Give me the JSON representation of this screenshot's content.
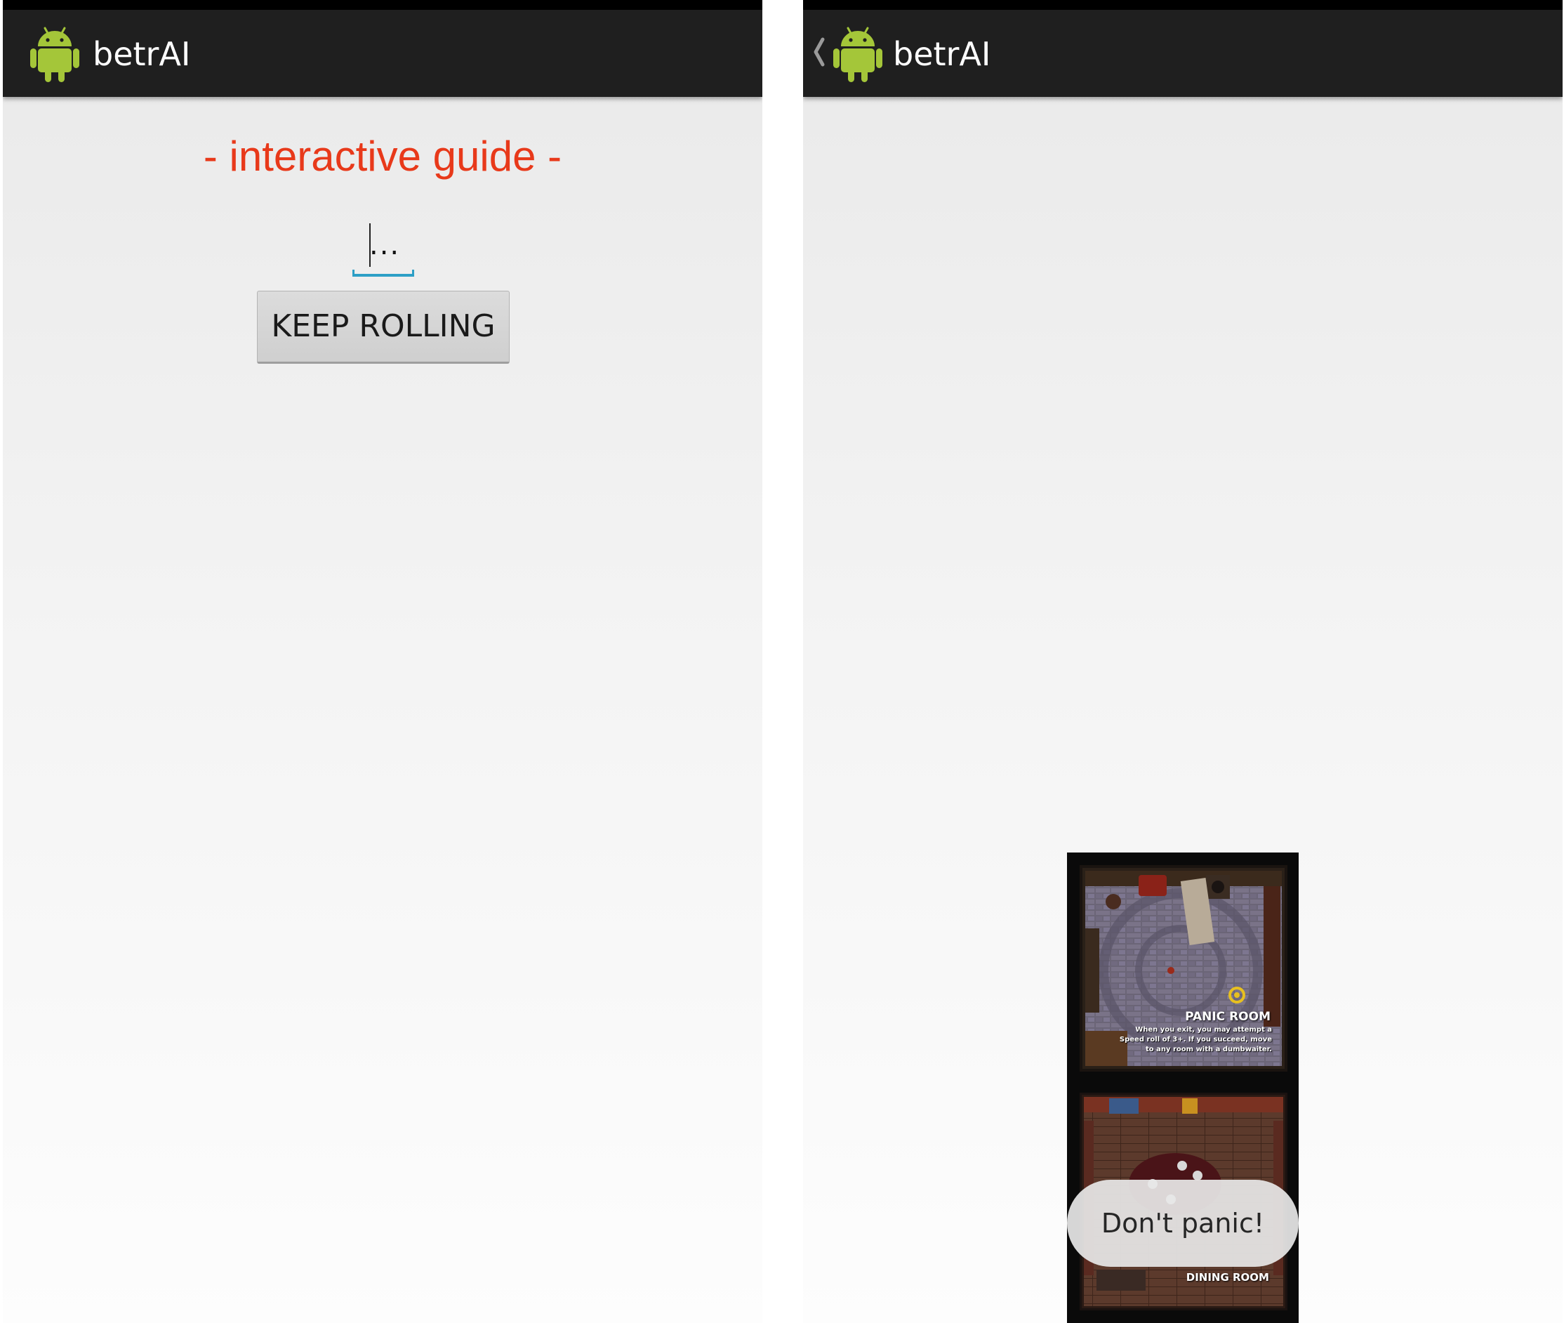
{
  "screens": [
    {
      "action_bar": {
        "app_icon": "android-robot-icon",
        "title": "betrAI"
      },
      "heading": "- interactive guide -",
      "roll_field": {
        "value": "..."
      },
      "button": {
        "label": "KEEP ROLLING"
      }
    },
    {
      "action_bar": {
        "up_icon": "chevron-left-icon",
        "app_icon": "android-robot-icon",
        "title": "betrAI"
      },
      "tiles": [
        {
          "name": "PANIC ROOM",
          "rule": "When you exit, you may attempt a Speed roll of 3+. If you succeed, move to any room with a dumbwaiter."
        },
        {
          "name": "DINING ROOM"
        }
      ],
      "toast": "Don't panic!"
    }
  ],
  "colors": {
    "action_bar": "#1f1f1f",
    "heading": "#e8391a",
    "field_underline": "#2d9fc6",
    "android_green": "#a4c639"
  }
}
